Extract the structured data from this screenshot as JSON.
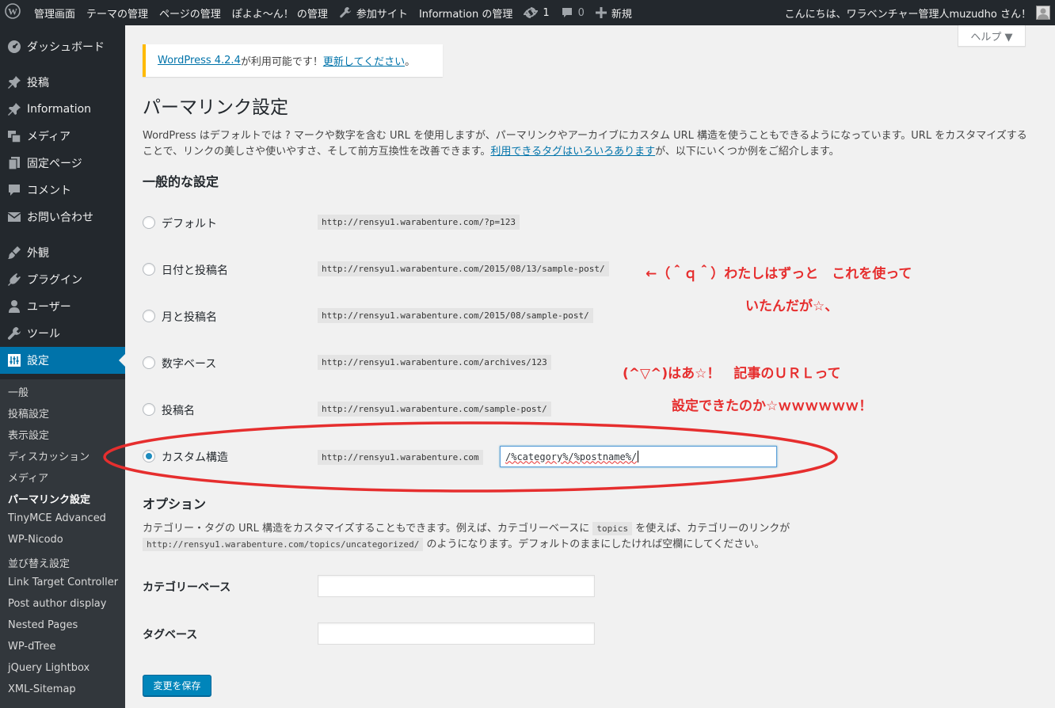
{
  "adminbar": {
    "site_name": "管理画面",
    "theme": "テーマの管理",
    "pages": "ページの管理",
    "poyoyo": "ぽよよ～ん！ の管理",
    "participating": "参加サイト",
    "information": "Information の管理",
    "updates_count": "1",
    "comments_count": "0",
    "new": "新規",
    "greeting": "こんにちは、ワラベンチャー管理人muzudho さん！"
  },
  "sidebar": {
    "menu": [
      {
        "label": "ダッシュボード",
        "icon": "dashboard-icon"
      },
      {
        "label": "投稿",
        "icon": "pin-icon"
      },
      {
        "label": "Information",
        "icon": "pin-icon"
      },
      {
        "label": "メディア",
        "icon": "media-icon"
      },
      {
        "label": "固定ページ",
        "icon": "page-icon"
      },
      {
        "label": "コメント",
        "icon": "comment-icon"
      },
      {
        "label": "お問い合わせ",
        "icon": "mail-icon"
      },
      {
        "label": "外観",
        "icon": "appearance-icon"
      },
      {
        "label": "プラグイン",
        "icon": "plugin-icon"
      },
      {
        "label": "ユーザー",
        "icon": "user-icon"
      },
      {
        "label": "ツール",
        "icon": "tool-icon"
      },
      {
        "label": "設定",
        "icon": "settings-icon"
      }
    ],
    "submenu": [
      "一般",
      "投稿設定",
      "表示設定",
      "ディスカッション",
      "メディア",
      "パーマリンク設定",
      "TinyMCE Advanced",
      "WP-Nicodo",
      "並び替え設定",
      "Link Target Controller",
      "Post author display",
      "Nested Pages",
      "WP-dTree",
      "jQuery Lightbox",
      "XML-Sitemap"
    ]
  },
  "help_tab": "ヘルプ ▼",
  "update_nag": {
    "link1": "WordPress 4.2.4",
    "text": " が利用可能です！",
    "link2": "更新してください",
    "end": "。"
  },
  "page_title": "パーマリンク設定",
  "intro": {
    "line1": "WordPress はデフォルトでは ? マークや数字を含む URL を使用しますが、パーマリンクやアーカイブにカスタム URL 構造を使うこともできるようになっています。URL をカスタマイズする",
    "line2_pre": "ことで、リンクの美しさや使いやすさ、そして前方互換性を改善できます。",
    "line2_link": "利用できるタグはいろいろあります",
    "line2_post": "が、以下にいくつか例をご紹介します。"
  },
  "common_settings_heading": "一般的な設定",
  "permalink_options": [
    {
      "label": "デフォルト",
      "example": "http://rensyu1.warabenture.com/?p=123"
    },
    {
      "label": "日付と投稿名",
      "example": "http://rensyu1.warabenture.com/2015/08/13/sample-post/"
    },
    {
      "label": "月と投稿名",
      "example": "http://rensyu1.warabenture.com/2015/08/sample-post/"
    },
    {
      "label": "数字ベース",
      "example": "http://rensyu1.warabenture.com/archives/123"
    },
    {
      "label": "投稿名",
      "example": "http://rensyu1.warabenture.com/sample-post/"
    },
    {
      "label": "カスタム構造",
      "example": "http://rensyu1.warabenture.com"
    }
  ],
  "custom_structure_value": "/%category%/%postname%/",
  "options_heading": "オプション",
  "options_desc": {
    "pre": "カテゴリー・タグの URL 構造をカスタマイズすることもできます。例えば、カテゴリーベースに ",
    "code": "topics",
    "post": " を使えば、カテゴリーのリンクが",
    "code2": "http://rensyu1.warabenture.com/topics/uncategorized/",
    "post2": " のようになります。デフォルトのままにしたければ空欄にしてください。"
  },
  "category_base_label": "カテゴリーベース",
  "tag_base_label": "タグベース",
  "save_button": "変更を保存",
  "annotations": {
    "a1": "←（＾ｑ＾）わたしはずっと　これを使って",
    "a2": "いたんだが☆、",
    "a3": "(^▽^)はあ☆！　記事のＵＲＬって",
    "a4": "設定できたのか☆ｗｗｗｗｗｗ！"
  },
  "colors": {
    "adminbar": "#23282d",
    "accent": "#0073aa",
    "annotation": "#e62e2e"
  }
}
